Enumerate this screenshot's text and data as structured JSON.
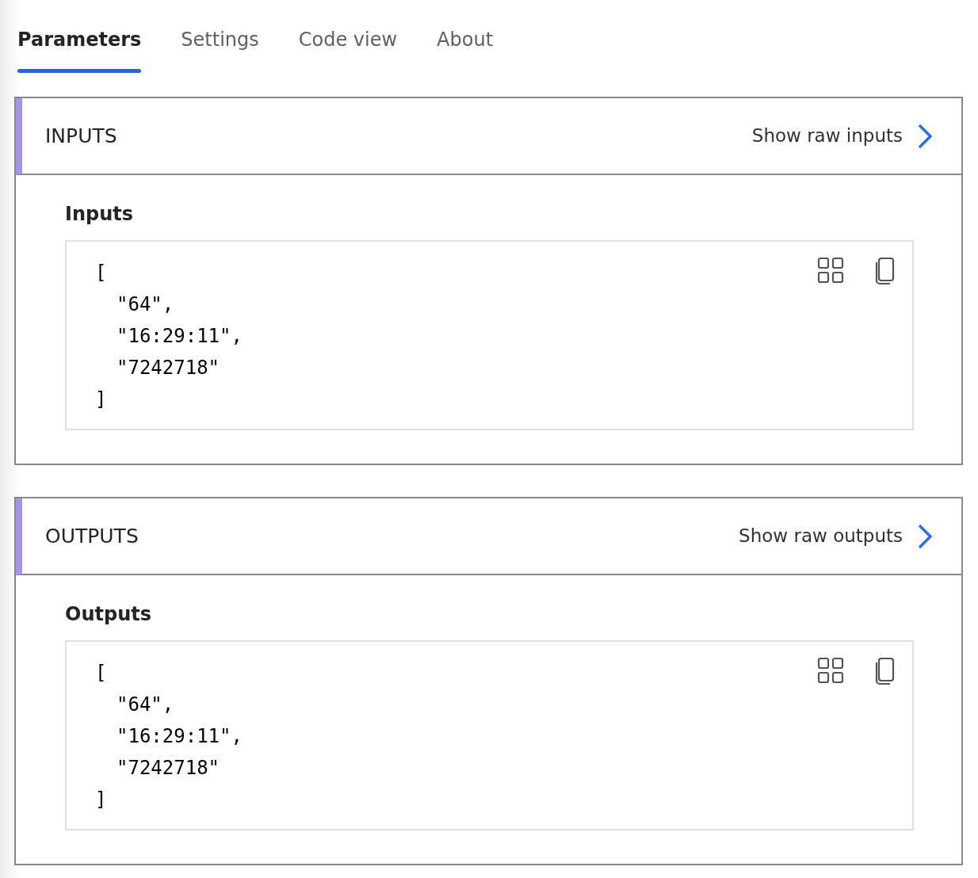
{
  "tabs": [
    {
      "label": "Parameters",
      "selected": true
    },
    {
      "label": "Settings",
      "selected": false
    },
    {
      "label": "Code view",
      "selected": false
    },
    {
      "label": "About",
      "selected": false
    }
  ],
  "sections": [
    {
      "title": "INPUTS",
      "link": "Show raw inputs",
      "label": "Inputs",
      "code": [
        {
          "text": "[",
          "children": [
            {
              "text": "\"64\","
            },
            {
              "text": "\"16:29:11\","
            },
            {
              "text": "\"7242718\""
            }
          ]
        },
        {
          "text": "]"
        }
      ]
    },
    {
      "title": "OUTPUTS",
      "link": "Show raw outputs",
      "label": "Outputs",
      "code": [
        {
          "text": "[",
          "children": [
            {
              "text": "\"64\","
            },
            {
              "text": "\"16:29:11\","
            },
            {
              "text": "\"7242718\""
            }
          ]
        },
        {
          "text": "]"
        }
      ]
    }
  ]
}
